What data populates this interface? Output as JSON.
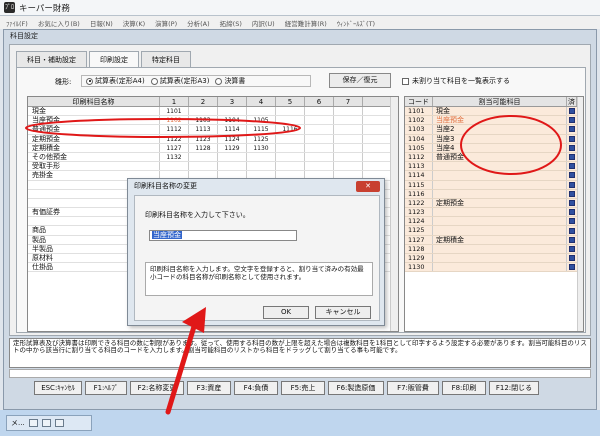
{
  "app": {
    "title": "キーパー財務",
    "icon": "ﾌﾟﾛ"
  },
  "menu": [
    "ﾌｧｲﾙ(F)",
    "お気に入り(B)",
    "日報(N)",
    "決算(K)",
    "演算(P)",
    "分析(A)",
    "拓締(S)",
    "内訳(U)",
    "経営難計算(R)",
    "ｳｨﾝﾄﾞｰﾙｽﾞ(T)"
  ],
  "window": {
    "title": "科目設定"
  },
  "tabs": [
    {
      "label": "科目・補助設定"
    },
    {
      "label": "印刷設定"
    },
    {
      "label": "特定科目"
    }
  ],
  "format": {
    "label": "雛形:",
    "options": [
      {
        "label": "試算表(定形A4)",
        "selected": true
      },
      {
        "label": "試算表(定形A3)",
        "selected": false
      },
      {
        "label": "決算書",
        "selected": false
      }
    ],
    "save_label": "保存／復元",
    "unassigned_check_label": "未割り当て科目を一覧表示する"
  },
  "grid": {
    "headers": [
      "印刷科目名称",
      "1",
      "2",
      "3",
      "4",
      "5",
      "6",
      "7"
    ],
    "rows": [
      {
        "name": "現金",
        "cells": [
          "1101",
          "",
          "",
          "",
          "",
          "",
          ""
        ]
      },
      {
        "name": "当座預金",
        "cells": [
          "1102",
          "1103",
          "1104",
          "1105",
          "",
          "",
          ""
        ],
        "hl_first": true
      },
      {
        "name": "普通預金",
        "cells": [
          "1112",
          "1113",
          "1114",
          "1115",
          "1116",
          "",
          ""
        ]
      },
      {
        "name": "定期預金",
        "cells": [
          "1122",
          "1123",
          "1124",
          "1125",
          "",
          "",
          ""
        ]
      },
      {
        "name": "定期積金",
        "cells": [
          "1127",
          "1128",
          "1129",
          "1130",
          "",
          "",
          ""
        ]
      },
      {
        "name": "その他預金",
        "cells": [
          "1132",
          "",
          "",
          "",
          "",
          "",
          ""
        ]
      },
      {
        "name": "受取手形",
        "cells": [
          "",
          "",
          "",
          "",
          "",
          "",
          ""
        ]
      },
      {
        "name": "売掛金",
        "cells": [
          "",
          "",
          "",
          "",
          "",
          "",
          ""
        ]
      },
      {
        "name": "",
        "cells": [
          "",
          "",
          "",
          "",
          "",
          "",
          ""
        ]
      },
      {
        "name": "",
        "cells": [
          "",
          "",
          "",
          "",
          "",
          "",
          ""
        ]
      },
      {
        "name": "",
        "cells": [
          "",
          "",
          "",
          "",
          "",
          "",
          ""
        ]
      },
      {
        "name": "有価証券",
        "cells": [
          "",
          "",
          "",
          "",
          "",
          "",
          ""
        ]
      },
      {
        "name": "",
        "cells": [
          "",
          "",
          "",
          "",
          "",
          "",
          ""
        ]
      },
      {
        "name": "商品",
        "cells": [
          "",
          "",
          "",
          "",
          "",
          "",
          ""
        ]
      },
      {
        "name": "製品",
        "cells": [
          "",
          "",
          "",
          "",
          "",
          "",
          ""
        ]
      },
      {
        "name": "半製品",
        "cells": [
          "",
          "",
          "",
          "",
          "",
          "",
          ""
        ]
      },
      {
        "name": "原材料",
        "cells": [
          "",
          "",
          "",
          "",
          "",
          "",
          ""
        ]
      },
      {
        "name": "仕掛品",
        "cells": [
          "",
          "",
          "",
          "",
          "",
          "",
          ""
        ]
      }
    ]
  },
  "rgrid": {
    "headers": [
      "コード",
      "割当可能科目",
      "済"
    ],
    "rows": [
      {
        "code": "1101",
        "name": "現金"
      },
      {
        "code": "1102",
        "name": "当座預金",
        "hl": true
      },
      {
        "code": "1103",
        "name": "当座2"
      },
      {
        "code": "1104",
        "name": "当座3"
      },
      {
        "code": "1105",
        "name": "当座4"
      },
      {
        "code": "1112",
        "name": "普通預金"
      },
      {
        "code": "1113",
        "name": ""
      },
      {
        "code": "1114",
        "name": ""
      },
      {
        "code": "1115",
        "name": ""
      },
      {
        "code": "1116",
        "name": ""
      },
      {
        "code": "1122",
        "name": "定期預金"
      },
      {
        "code": "1123",
        "name": ""
      },
      {
        "code": "1124",
        "name": ""
      },
      {
        "code": "1125",
        "name": ""
      },
      {
        "code": "1127",
        "name": "定期積金"
      },
      {
        "code": "1128",
        "name": ""
      },
      {
        "code": "1129",
        "name": ""
      },
      {
        "code": "1130",
        "name": ""
      }
    ]
  },
  "info_text": "定形試算表及び決算書は印刷できる科目の数に制限があります。従って、使用する科目の数が上限を超えた場合は複数科目を1科目として印字するよう設定する必要があります。割当可能科目のリストの中から該当行に割り当てる科目のコードを入力します。割当可能科目のリストから科目をドラッグして割り当てる事も可能です。",
  "fkeys": [
    "ESC:ｷｬﾝｾﾙ",
    "F1:ﾍﾙﾌﾟ",
    "F2:名称変更",
    "F3:資産",
    "F4:負債",
    "F5:売上",
    "F6:製造原価",
    "F7:販管費",
    "F8:印刷",
    "F12:閉じる"
  ],
  "dialog": {
    "title": "印刷科目名称の変更",
    "close": "✕",
    "prompt": "印刷科目名称を入力して下さい。",
    "value": "当座預金",
    "help": "印刷科目名称を入力します。空文字を登録すると、割り当て済みの有効最小コードの科目名称が印刷名称として使用されます。",
    "ok": "OK",
    "cancel": "キャンセル"
  },
  "taskbar": {
    "label": "メ..."
  },
  "colors": {
    "annotation": "#e01818",
    "highlight_text": "#e07040",
    "row_bg": "#fbeadb"
  }
}
